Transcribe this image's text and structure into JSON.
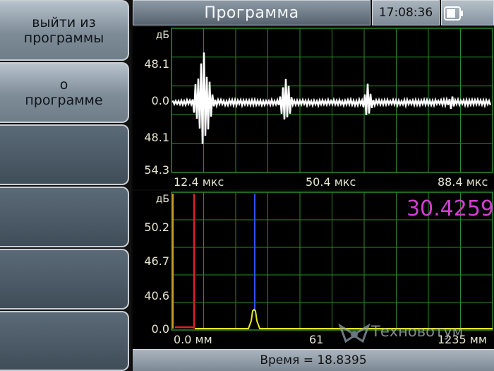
{
  "sidebar": {
    "buttons": [
      {
        "label": "выйти из\nпрограммы"
      },
      {
        "label": "о\nпрограмме"
      },
      {
        "label": ""
      },
      {
        "label": ""
      },
      {
        "label": ""
      },
      {
        "label": ""
      }
    ]
  },
  "header": {
    "title": "Программа",
    "time": "17:08:36"
  },
  "scope_top": {
    "unit": "дБ",
    "y_ticks": [
      "48.1",
      "0.0",
      "48.1",
      "54.3"
    ],
    "x_ticks": [
      "12.4 мкс",
      "50.4 мкс",
      "88.4 мкс"
    ]
  },
  "scope_bottom": {
    "unit": "дБ",
    "y_ticks": [
      "50.2",
      "46.7",
      "40.6",
      "0.0"
    ],
    "x_ticks": [
      "0.0 мм",
      "61",
      "1235 мм"
    ],
    "readout": "30.4259"
  },
  "status": {
    "time_readout": "Время = 18.8395"
  },
  "watermark": {
    "text": "Техновотум"
  },
  "colors": {
    "grid": "#2a8a2a",
    "waveform": "#ffffff",
    "red_gate": "#e02020",
    "blue_marker": "#3050ff",
    "yellow_trace": "#e6e61e",
    "readout": "#cf3fd0"
  }
}
